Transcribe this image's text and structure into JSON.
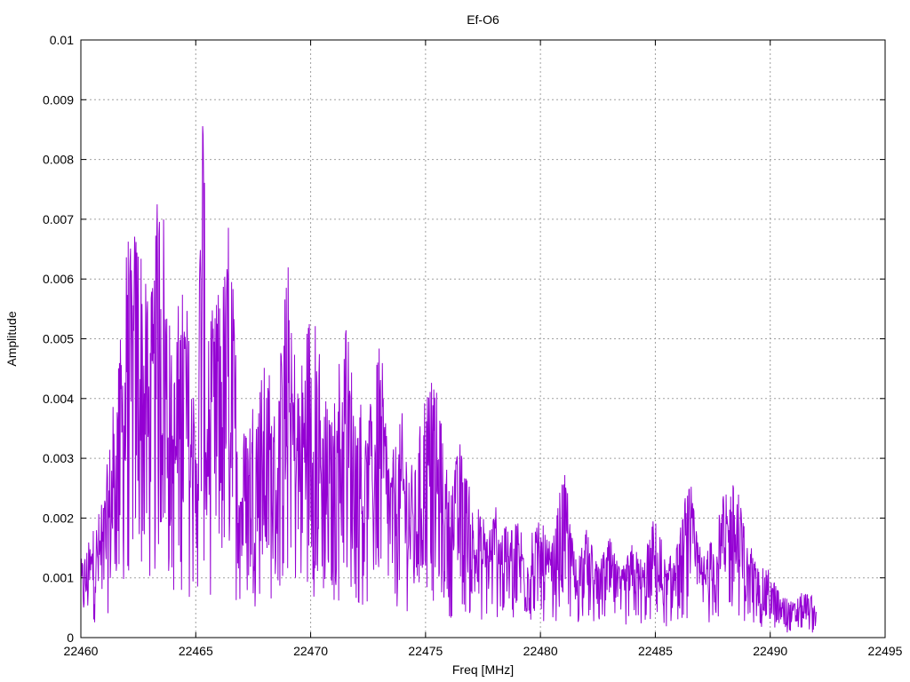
{
  "chart_data": {
    "type": "line",
    "title": "Ef-O6",
    "xlabel": "Freq [MHz]",
    "ylabel": "Amplitude",
    "xlim": [
      22460,
      22495
    ],
    "ylim": [
      0,
      0.01
    ],
    "xticks": [
      "22460",
      "22465",
      "22470",
      "22475",
      "22480",
      "22485",
      "22490",
      "22495"
    ],
    "yticks": [
      "0",
      "0.001",
      "0.002",
      "0.003",
      "0.004",
      "0.005",
      "0.006",
      "0.007",
      "0.008",
      "0.009",
      "0.01"
    ],
    "grid": true,
    "series": [
      {
        "color": "#9400d3",
        "x": [
          22460,
          22460.5,
          22461,
          22461.5,
          22462,
          22462.5,
          22463,
          22463.5,
          22464,
          22464.5,
          22465,
          22465.3,
          22465.5,
          22466,
          22466.5,
          22467,
          22467.5,
          22468,
          22468.5,
          22469,
          22469.5,
          22470,
          22470.5,
          22471,
          22471.5,
          22472,
          22472.5,
          22473,
          22473.5,
          22474,
          22474.5,
          22475,
          22475.5,
          22476,
          22476.5,
          22477,
          22477.5,
          22478,
          22478.5,
          22479,
          22479.5,
          22480,
          22480.5,
          22481,
          22481.5,
          22482,
          22482.5,
          22483,
          22483.5,
          22484,
          22484.5,
          22485,
          22485.5,
          22486,
          22486.5,
          22487,
          22487.5,
          22488,
          22488.5,
          22489,
          22489.5,
          22490,
          22490.5,
          22491,
          22491.5,
          22492
        ],
        "y": [
          0.0013,
          0.0018,
          0.0024,
          0.0042,
          0.0062,
          0.0073,
          0.0052,
          0.0082,
          0.0044,
          0.0063,
          0.0035,
          0.0095,
          0.0048,
          0.0058,
          0.0068,
          0.0033,
          0.0042,
          0.0046,
          0.0038,
          0.006,
          0.0044,
          0.0058,
          0.0042,
          0.0036,
          0.0056,
          0.004,
          0.0034,
          0.0051,
          0.003,
          0.0038,
          0.0027,
          0.0044,
          0.0041,
          0.0025,
          0.0033,
          0.0023,
          0.0019,
          0.0022,
          0.0018,
          0.0021,
          0.0016,
          0.002,
          0.0015,
          0.0029,
          0.0014,
          0.0018,
          0.0012,
          0.0017,
          0.0011,
          0.0016,
          0.0013,
          0.002,
          0.0012,
          0.0017,
          0.0026,
          0.0014,
          0.0017,
          0.0024,
          0.0027,
          0.0016,
          0.0012,
          0.0011,
          0.0007,
          0.0006,
          0.0008,
          0.0006
        ]
      }
    ]
  }
}
